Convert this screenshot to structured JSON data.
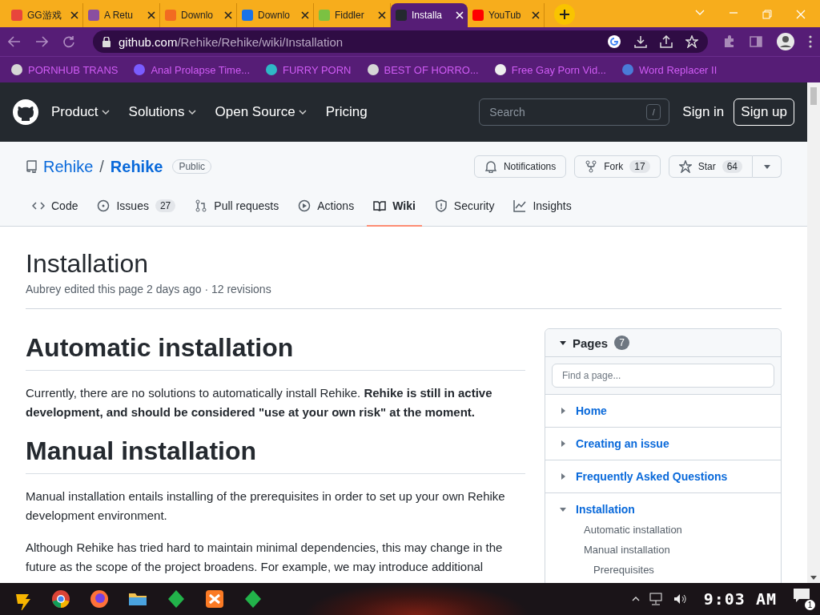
{
  "browser": {
    "tabs": [
      {
        "title": "GG游戏",
        "color": "#e8453c",
        "selected": false
      },
      {
        "title": "A Retu",
        "color": "#8a4fa0",
        "selected": false
      },
      {
        "title": "Downlo",
        "color": "#f26b21",
        "selected": false
      },
      {
        "title": "Downlo",
        "color": "#1a73e8",
        "selected": false
      },
      {
        "title": "Fiddler",
        "color": "#7bc142",
        "selected": false
      },
      {
        "title": "Installa",
        "color": "#24292f",
        "selected": true
      },
      {
        "title": "YouTub",
        "color": "#ff0000",
        "selected": false
      }
    ],
    "url": {
      "host": "github.com",
      "path": "/Rehike/Rehike/wiki/Installation"
    },
    "bookmarks": [
      {
        "title": "PORNHUB TRANS",
        "color": "#d6d6d6"
      },
      {
        "title": "Anal Prolapse Time...",
        "color": "#7a5cff"
      },
      {
        "title": "FURRY PORN",
        "color": "#2fb8c6"
      },
      {
        "title": "BEST OF HORRO...",
        "color": "#d6d6d6"
      },
      {
        "title": "Free Gay Porn Vid...",
        "color": "#eeeeee"
      },
      {
        "title": "Word Replacer II",
        "color": "#4a7bd8"
      }
    ]
  },
  "github_header": {
    "nav": [
      {
        "label": "Product",
        "dropdown": true
      },
      {
        "label": "Solutions",
        "dropdown": true
      },
      {
        "label": "Open Source",
        "dropdown": true
      },
      {
        "label": "Pricing",
        "dropdown": false
      }
    ],
    "search": {
      "placeholder": "Search",
      "key": "/"
    },
    "sign_in": "Sign in",
    "sign_up": "Sign up"
  },
  "repo": {
    "owner": "Rehike",
    "separator": "/",
    "name": "Rehike",
    "visibility": "Public",
    "actions": [
      {
        "kind": "bell",
        "label": "Notifications"
      },
      {
        "kind": "fork",
        "label": "Fork",
        "count": "17"
      },
      {
        "kind": "star",
        "label": "Star",
        "count": "64"
      }
    ],
    "tabs": [
      {
        "kind": "code",
        "label": "Code",
        "selected": false
      },
      {
        "kind": "issues",
        "label": "Issues",
        "count": "27",
        "selected": false
      },
      {
        "kind": "pull",
        "label": "Pull requests",
        "selected": false
      },
      {
        "kind": "actions",
        "label": "Actions",
        "selected": false
      },
      {
        "kind": "wiki",
        "label": "Wiki",
        "selected": true
      },
      {
        "kind": "security",
        "label": "Security",
        "selected": false
      },
      {
        "kind": "insights",
        "label": "Insights",
        "selected": false
      }
    ]
  },
  "wiki": {
    "title": "Installation",
    "meta": "Aubrey edited this page 2 days ago · 12 revisions",
    "content": [
      {
        "kind": "heading",
        "text": "Automatic installation"
      },
      {
        "kind": "paragraph",
        "text": "Currently, there are no solutions to automatically install Rehike. **Rehike is still in active development, and should be considered \"use at your own risk\" at the moment.**"
      },
      {
        "kind": "heading",
        "text": "Manual installation"
      },
      {
        "kind": "paragraph",
        "text": "Manual installation entails installing of the prerequisites in order to set up your own Rehike development environment."
      },
      {
        "kind": "paragraph",
        "text": "Although Rehike has tried hard to maintain minimal dependencies, this may change in the future as the scope of the project broadens. For example, we may introduce additional"
      }
    ]
  },
  "sidebar": {
    "title": "Pages",
    "count": "7",
    "expanded": true,
    "search": {
      "placeholder": "Find a page..."
    },
    "pages": [
      {
        "label": "Home",
        "expanded": false
      },
      {
        "label": "Creating an issue",
        "expanded": false
      },
      {
        "label": "Frequently Asked Questions",
        "expanded": false
      },
      {
        "label": "Installation",
        "expanded": true,
        "children": [
          {
            "label": "Automatic installation"
          },
          {
            "label": "Manual installation",
            "children": [
              {
                "label": "Prerequisites"
              }
            ]
          }
        ]
      }
    ]
  },
  "taskbar": {
    "time": "9:03 AM",
    "notifications": "1"
  }
}
